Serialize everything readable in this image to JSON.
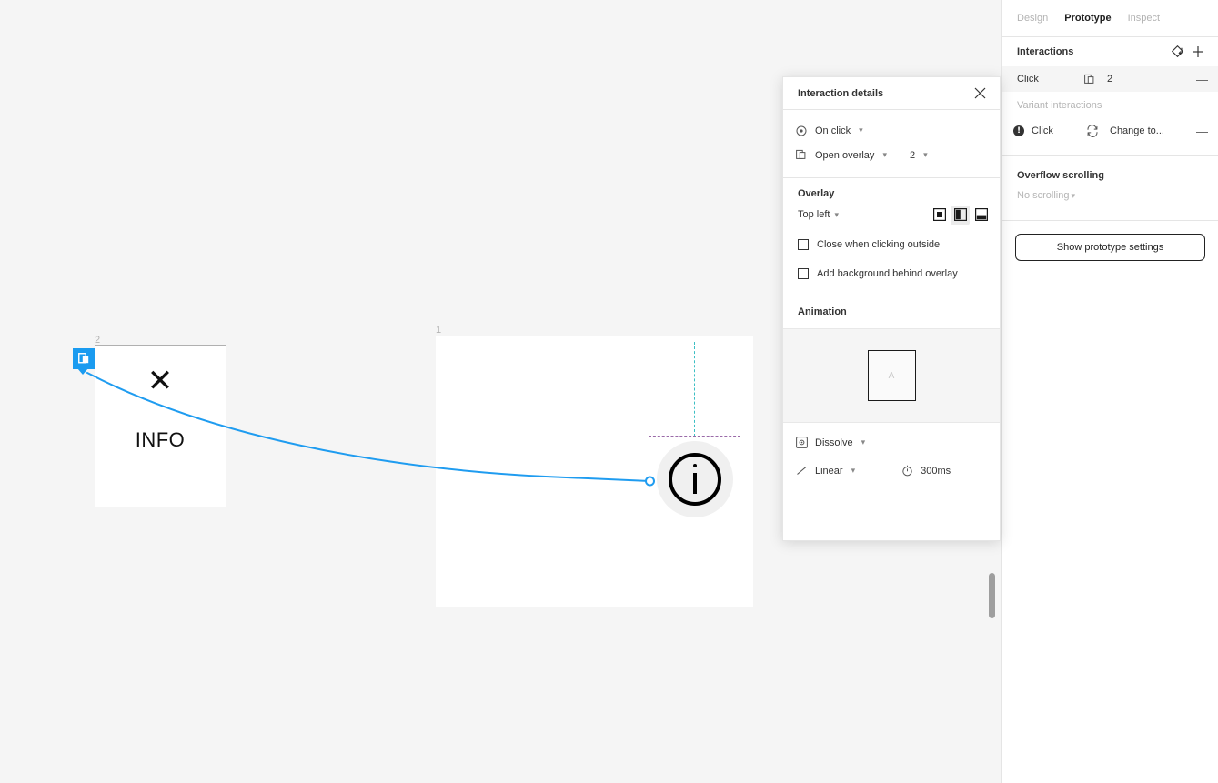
{
  "sidebar": {
    "tabs": [
      {
        "label": "Design",
        "active": false
      },
      {
        "label": "Prototype",
        "active": true
      },
      {
        "label": "Inspect",
        "active": false
      }
    ],
    "interactions": {
      "title": "Interactions",
      "reset_icon": "reset-interactions-icon",
      "add_icon": "plus-icon",
      "rows": [
        {
          "trigger": "Click",
          "action_icon": "open-overlay-icon",
          "destination": "2",
          "remove_label": "—"
        }
      ],
      "variant_section_label": "Variant interactions",
      "variant_rows": [
        {
          "warning": "!",
          "trigger": "Click",
          "action_icon": "swap-variant-icon",
          "destination": "Change to...",
          "remove_label": "—"
        }
      ]
    },
    "overflow_scrolling": {
      "title": "Overflow scrolling",
      "value": "No scrolling"
    },
    "prototype_settings_button": "Show prototype settings"
  },
  "interaction_details": {
    "title": "Interaction details",
    "close_icon": "close-icon",
    "trigger": {
      "icon": "on-click-icon",
      "label": "On click"
    },
    "action": {
      "icon": "open-overlay-icon",
      "label": "Open overlay",
      "destination": "2"
    },
    "overlay": {
      "section_title": "Overlay",
      "position": "Top left",
      "position_buttons": [
        {
          "icon": "align-center-icon",
          "active": false
        },
        {
          "icon": "align-left-half-icon",
          "active": true
        },
        {
          "icon": "align-bottom-half-icon",
          "active": false
        }
      ],
      "checkboxes": [
        {
          "label": "Close when clicking outside",
          "checked": false
        },
        {
          "label": "Add background behind overlay",
          "checked": false
        }
      ]
    },
    "animation": {
      "section_title": "Animation",
      "preview_letter": "A",
      "type_icon": "dissolve-icon",
      "type": "Dissolve",
      "easing_icon": "linear-easing-icon",
      "easing": "Linear",
      "duration_icon": "stopwatch-icon",
      "duration": "300ms"
    }
  },
  "canvas": {
    "frames": [
      {
        "name": "2",
        "badge_icon": "open-overlay-badge-icon",
        "close_glyph": "✕",
        "body_text": "INFO"
      },
      {
        "name": "1",
        "instance_icon": "info-circle-icon"
      }
    ]
  },
  "colors": {
    "accent_blue": "#1a9bf0",
    "connector_blue": "#1f9cf0",
    "selection_dash": "#9a6aa8",
    "guide_teal": "#3bbfc4",
    "canvas_bg": "#f5f5f5",
    "panel_bg": "#ffffff",
    "row_highlight": "#f5f5f5",
    "muted_text": "#b3b3b3"
  }
}
